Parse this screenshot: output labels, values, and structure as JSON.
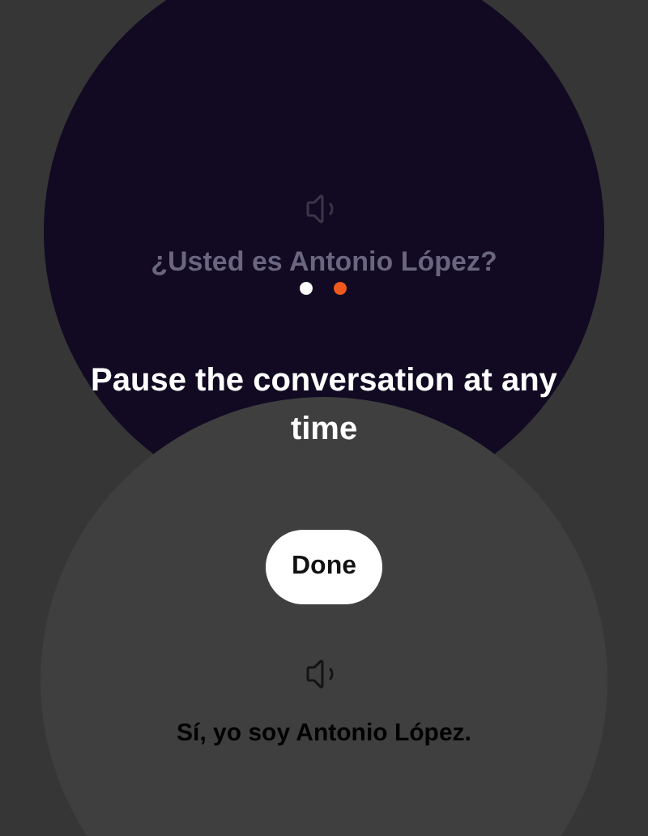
{
  "prompt": {
    "text": "¿Usted es Antonio López?"
  },
  "page_dots": [
    {
      "selected": false
    },
    {
      "selected": true
    }
  ],
  "tip": {
    "title": "Pause the conversation at any time",
    "button": "Done"
  },
  "reply": {
    "text": "Sí, yo soy Antonio López."
  }
}
